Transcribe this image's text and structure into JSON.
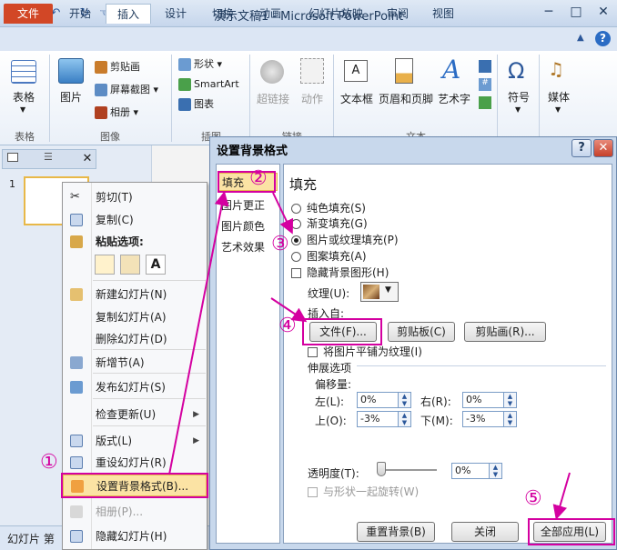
{
  "window": {
    "title": "演示文稿1 - Microsoft PowerPoint",
    "app_icon": "P"
  },
  "ribbon_tabs": [
    "文件",
    "开始",
    "插入",
    "设计",
    "切换",
    "动画",
    "幻灯片放映",
    "审阅",
    "视图"
  ],
  "groups": {
    "table": {
      "label": "表格",
      "button": "表格"
    },
    "image": {
      "label": "图像",
      "picture": "图片",
      "clipart": "剪贴画",
      "screenshot": "屏幕截图",
      "album": "相册"
    },
    "illustration": {
      "label": "插图",
      "shapes": "形状",
      "smartart": "SmartArt",
      "chart": "图表"
    },
    "links": {
      "label": "链接",
      "hyperlink": "超链接",
      "action": "动作"
    },
    "text": {
      "label": "文本",
      "textbox": "文本框",
      "headerfooter": "页眉和页脚",
      "wordart": "艺术字"
    },
    "symbols": {
      "symbol": "符号"
    },
    "media": {
      "media": "媒体"
    }
  },
  "left_pane": {
    "slide_number": "1",
    "status": "幻灯片 第"
  },
  "context_menu": {
    "items": [
      {
        "label": "剪切(T)",
        "icon": "scissors-icon"
      },
      {
        "label": "复制(C)",
        "icon": "copy-icon"
      },
      {
        "label": "粘贴选项:",
        "icon": "paste-icon",
        "bold": true
      },
      {
        "label": "新建幻灯片(N)",
        "icon": "new-slide-icon"
      },
      {
        "label": "复制幻灯片(A)",
        "icon": ""
      },
      {
        "label": "删除幻灯片(D)",
        "icon": ""
      },
      {
        "label": "新增节(A)",
        "icon": "section-icon"
      },
      {
        "label": "发布幻灯片(S)",
        "icon": "publish-icon"
      },
      {
        "label": "检查更新(U)",
        "icon": "",
        "submenu": true
      },
      {
        "label": "版式(L)",
        "icon": "layout-icon",
        "submenu": true
      },
      {
        "label": "重设幻灯片(R)",
        "icon": "reset-icon"
      },
      {
        "label": "设置背景格式(B)...",
        "icon": "background-icon",
        "highlight": true
      },
      {
        "label": "相册(P)...",
        "icon": "album-icon",
        "disabled": true
      },
      {
        "label": "隐藏幻灯片(H)",
        "icon": "hide-slide-icon"
      }
    ]
  },
  "dialog": {
    "title": "设置背景格式",
    "help": "?",
    "close": "✕",
    "categories": [
      "填充",
      "图片更正",
      "图片颜色",
      "艺术效果"
    ],
    "fill": {
      "heading": "填充",
      "options": [
        "纯色填充(S)",
        "渐变填充(G)",
        "图片或纹理填充(P)",
        "图案填充(A)"
      ],
      "selected": 2,
      "hide_bg": "隐藏背景图形(H)",
      "texture_label": "纹理(U):",
      "insert_from": "插入自:",
      "btn_file": "文件(F)...",
      "btn_clipboard": "剪贴板(C)",
      "btn_clipart": "剪贴画(R)...",
      "tile": "将图片平铺为纹理(I)",
      "stretch_opts": "伸展选项",
      "offset": "偏移量:",
      "left_label": "左(L):",
      "left_val": "0%",
      "right_label": "右(R):",
      "right_val": "0%",
      "top_label": "上(O):",
      "top_val": "-3%",
      "bottom_label": "下(M):",
      "bottom_val": "-3%",
      "transparency": "透明度(T):",
      "transparency_val": "0%",
      "transparency_level": 0,
      "rotate": "与形状一起旋转(W)"
    },
    "buttons": {
      "reset": "重置背景(B)",
      "close": "关闭",
      "apply_all": "全部应用(L)"
    }
  },
  "annotations": [
    "①",
    "②",
    "③",
    "④",
    "⑤"
  ],
  "colors": {
    "accent": "#d400a0",
    "file_tab": "#d24726",
    "highlight": "#fbe3a4"
  }
}
